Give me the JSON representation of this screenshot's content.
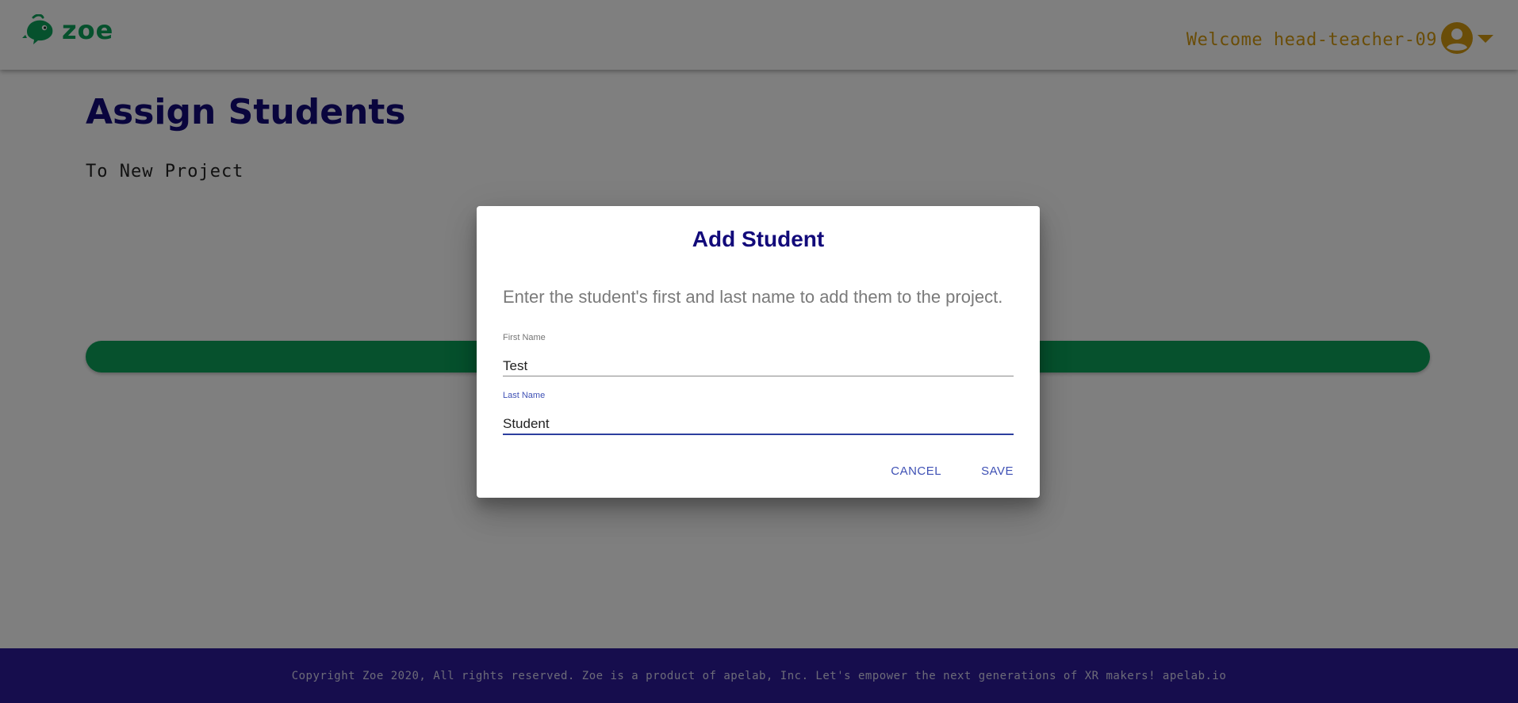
{
  "header": {
    "logo_text": "zoe",
    "welcome_text": "Welcome head-teacher-09"
  },
  "main": {
    "title": "Assign Students",
    "subtitle": "To New Project"
  },
  "footer": {
    "text": "Copyright Zoe 2020, All rights reserved. Zoe is a product of apelab, Inc. Let's empower the next generations of XR makers! apelab.io"
  },
  "dialog": {
    "title": "Add Student",
    "description": "Enter the student's first and last name to add them to the project.",
    "first_name": {
      "label": "First Name",
      "value": "Test"
    },
    "last_name": {
      "label": "Last Name",
      "value": "Student"
    },
    "cancel_label": "CANCEL",
    "save_label": "SAVE"
  },
  "colors": {
    "brand_green": "#0da35b",
    "title_navy": "#120a7a",
    "welcome_gold": "#d49a10",
    "footer_purple": "#2d1b9b",
    "dialog_button_blue": "#3f51b5"
  },
  "icons": {
    "logo": "zoe-chameleon-logo-icon",
    "avatar": "account-circle-icon",
    "menu": "caret-down-icon"
  }
}
